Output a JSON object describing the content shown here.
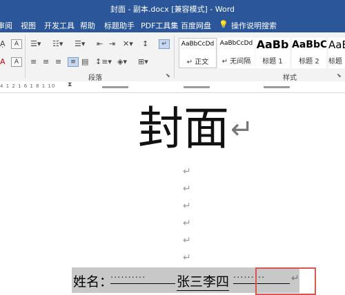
{
  "window": {
    "title": "封面 - 副本.docx [兼容模式] - Word"
  },
  "menu": {
    "items": [
      "审阅",
      "视图",
      "开发工具",
      "帮助",
      "标题助手",
      "PDF工具集",
      "百度网盘"
    ],
    "tell_me": "操作说明搜索"
  },
  "ribbon": {
    "paragraph_group": "段落",
    "styles_group": "样式",
    "styles": [
      {
        "sample": "AaBbCcDd",
        "name": "↵ 正文"
      },
      {
        "sample": "AaBbCcDd",
        "name": "↵ 无间隔"
      },
      {
        "sample": "AaBb",
        "name": "标题 1"
      },
      {
        "sample": "AaBbC",
        "name": "标题 2"
      },
      {
        "sample": "AaB",
        "name": "标题"
      }
    ]
  },
  "ruler": {
    "numbers": "4 1 2 1 6 1 8 1 10"
  },
  "document": {
    "heading": "封面",
    "paragraph_mark": "↵",
    "name_label": "姓名：",
    "name_value": "张三李四",
    "leader_dots_left": "··········",
    "leader_dots_right": "·········"
  },
  "colors": {
    "accent": "#2b579a",
    "highlight_box": "#d9534f"
  }
}
